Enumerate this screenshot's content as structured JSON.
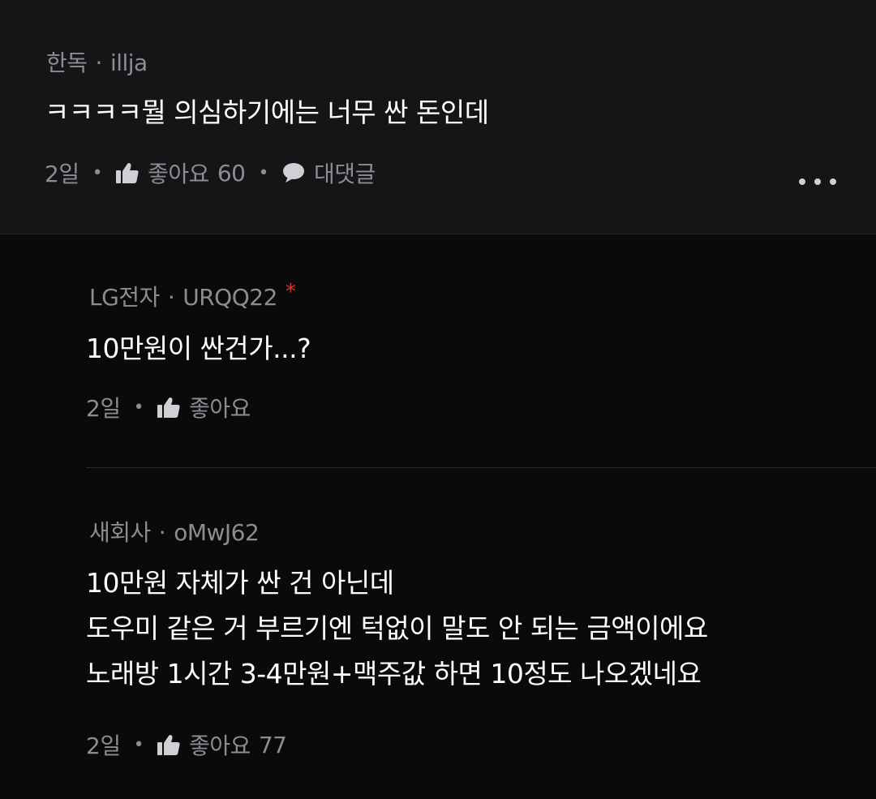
{
  "top_comment": {
    "author_group": "한독",
    "separator": "·",
    "author_id": "illja",
    "text": "ㅋㅋㅋㅋ뭘 의심하기에는 너무 싼 돈인데",
    "time": "2일",
    "like_label": "좋아요",
    "like_count": "60",
    "reply_label": "대댓글"
  },
  "replies": [
    {
      "author_group": "LG전자",
      "separator": "·",
      "author_id": "URQQ22",
      "badge": "*",
      "text": "10만원이 싼건가...?",
      "time": "2일",
      "like_label": "좋아요"
    },
    {
      "author_group": "새회사",
      "separator": "·",
      "author_id": "oMwJ62",
      "lines": [
        "10만원 자체가 싼 건 아닌데",
        "도우미 같은 거 부르기엔 턱없이 말도 안 되는 금액이에요",
        "노래방 1시간 3-4만원+맥주값 하면 10정도 나오겠네요"
      ],
      "time": "2일",
      "like_label": "좋아요",
      "like_count": "77"
    }
  ],
  "icons": {
    "like": "thumbs-up-icon",
    "reply": "speech-bubble-icon",
    "more": "more-horizontal-icon"
  },
  "colors": {
    "background": "#0a0a0b",
    "top_comment_background": "#151517",
    "meta_text": "#8c8c92",
    "body_text": "#ffffff",
    "badge": "#d9362b"
  }
}
